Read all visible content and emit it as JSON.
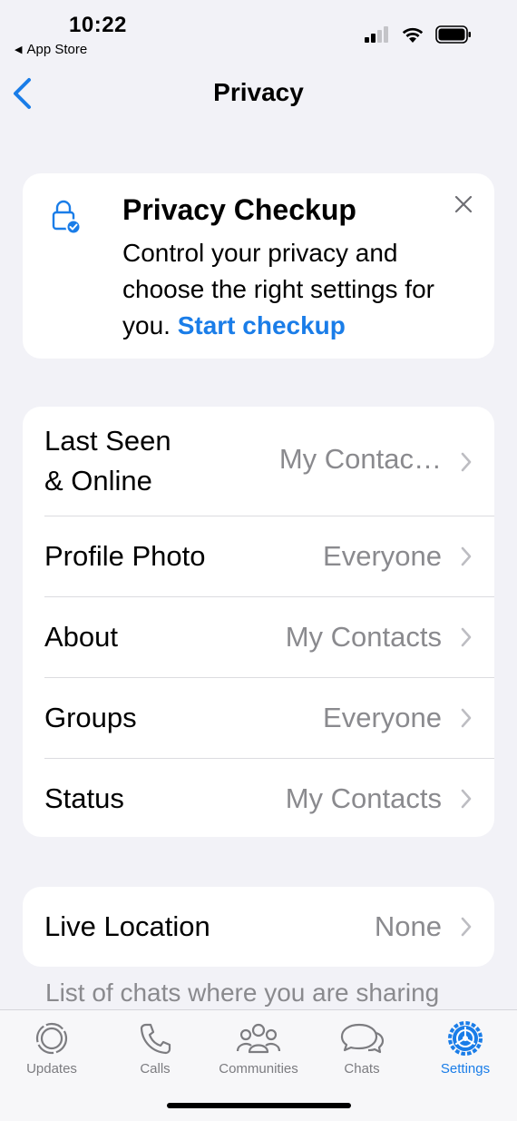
{
  "status_bar": {
    "time": "10:22",
    "back_app": "App Store"
  },
  "nav": {
    "title": "Privacy"
  },
  "checkup": {
    "title": "Privacy Checkup",
    "body": "Control your privacy and choose the right settings for you. ",
    "link": "Start checkup"
  },
  "settings": {
    "rows": [
      {
        "label_line1": "Last Seen",
        "label_line2": "& Online",
        "value": "My Contac…"
      },
      {
        "label": "Profile Photo",
        "value": "Everyone"
      },
      {
        "label": "About",
        "value": "My Contacts"
      },
      {
        "label": "Groups",
        "value": "Everyone"
      },
      {
        "label": "Status",
        "value": "My Contacts"
      }
    ]
  },
  "live_location": {
    "label": "Live Location",
    "value": "None",
    "footnote": "List of chats where you are sharing"
  },
  "tabs": [
    {
      "label": "Updates",
      "icon": "updates-icon"
    },
    {
      "label": "Calls",
      "icon": "phone-icon"
    },
    {
      "label": "Communities",
      "icon": "communities-icon"
    },
    {
      "label": "Chats",
      "icon": "chats-icon"
    },
    {
      "label": "Settings",
      "icon": "settings-icon"
    }
  ],
  "colors": {
    "accent": "#1a7de8",
    "background": "#f2f2f7",
    "secondary_text": "#8a8a8e"
  }
}
